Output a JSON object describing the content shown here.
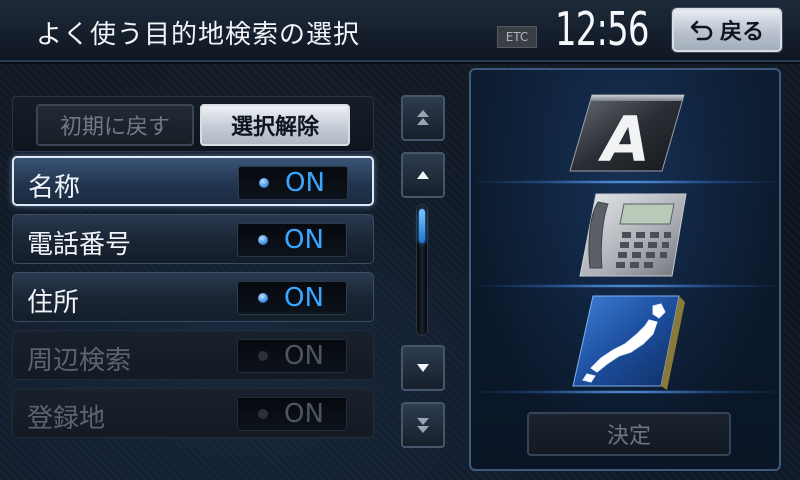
{
  "header": {
    "title": "よく使う目的地検索の選択",
    "etc_label": "ETC",
    "clock": "12:56",
    "back_label": "戻る"
  },
  "actions": {
    "reset_label": "初期に戻す",
    "clear_label": "選択解除"
  },
  "items": [
    {
      "label": "名称",
      "toggle": "ON",
      "state": "selected"
    },
    {
      "label": "電話番号",
      "toggle": "ON",
      "state": "enabled"
    },
    {
      "label": "住所",
      "toggle": "ON",
      "state": "enabled"
    },
    {
      "label": "周辺検索",
      "toggle": "ON",
      "state": "disabled"
    },
    {
      "label": "登録地",
      "toggle": "ON",
      "state": "disabled"
    }
  ],
  "scroll": {
    "icons": [
      "page-up-icon",
      "arrow-up-icon",
      "arrow-down-icon",
      "page-down-icon"
    ]
  },
  "preview_panel": {
    "icons": [
      "letter-a-icon",
      "telephone-icon",
      "japan-map-icon"
    ],
    "decide_label": "決定"
  },
  "colors": {
    "accent_on": "#39a6ff",
    "panel_border": "#3c5a7e"
  }
}
